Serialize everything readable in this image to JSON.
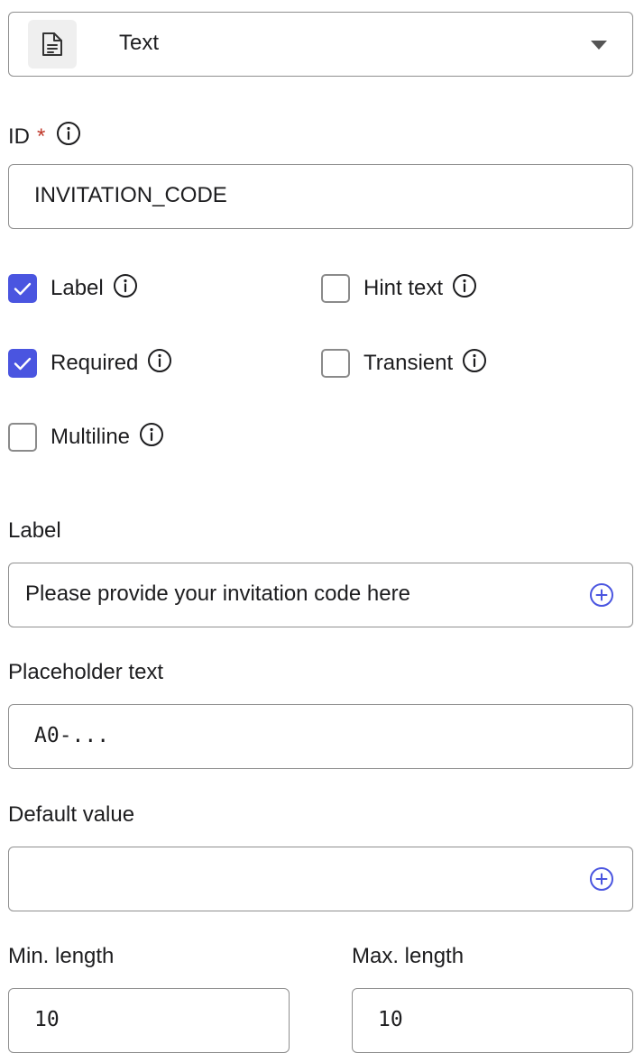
{
  "type_select": {
    "value": "Text",
    "icon": "document-icon"
  },
  "id_field": {
    "label": "ID",
    "required_mark": "*",
    "value": "INVITATION_CODE"
  },
  "options": [
    {
      "key": "label",
      "text": "Label",
      "checked": true
    },
    {
      "key": "hint_text",
      "text": "Hint text",
      "checked": false
    },
    {
      "key": "required",
      "text": "Required",
      "checked": true
    },
    {
      "key": "transient",
      "text": "Transient",
      "checked": false
    },
    {
      "key": "multiline",
      "text": "Multiline",
      "checked": false
    }
  ],
  "label_field": {
    "label": "Label",
    "value": "Please provide your invitation code here"
  },
  "placeholder_field": {
    "label": "Placeholder text",
    "value": "A0-..."
  },
  "default_field": {
    "label": "Default value",
    "value": ""
  },
  "min_length": {
    "label": "Min. length",
    "value": "10"
  },
  "max_length": {
    "label": "Max. length",
    "value": "10"
  },
  "colors": {
    "accent": "#4a55e0",
    "required": "#c0392b",
    "border": "#8f8f8f"
  }
}
